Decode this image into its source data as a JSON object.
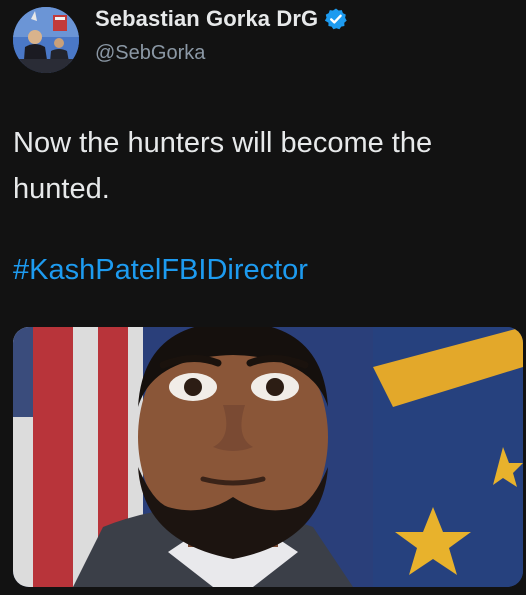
{
  "author": {
    "display_name": "Sebastian Gorka DrG",
    "handle": "@SebGorka",
    "avatar_icon": "profile-photo-avatar",
    "verified_icon": "verified-badge-icon",
    "verified_color": "#1d9bf0"
  },
  "tweet": {
    "text": "Now the hunters will become the hunted.",
    "hashtag": "#KashPatelFBIDirector"
  },
  "media": {
    "icon": "photo-portrait-with-flags"
  },
  "colors": {
    "background": "#121212",
    "text": "#e7e9ea",
    "secondary_text": "#8b98a5",
    "link": "#1d9bf0"
  }
}
